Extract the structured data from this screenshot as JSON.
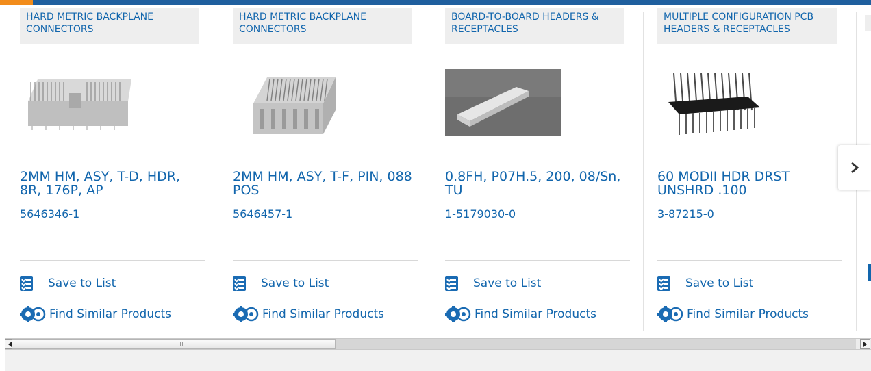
{
  "products": [
    {
      "category": "HARD METRIC BACKPLANE CONNECTORS",
      "title": "2MM HM, ASY, T-D, HDR, 8R, 176P, AP",
      "part_number": "5646346-1",
      "save_label": "Save to List",
      "similar_label": "Find Similar Products"
    },
    {
      "category": "HARD METRIC BACKPLANE CONNECTORS",
      "title": "2MM HM, ASY, T-F, PIN, 088 POS",
      "part_number": "5646457-1",
      "save_label": "Save to List",
      "similar_label": "Find Similar Products"
    },
    {
      "category": "BOARD-TO-BOARD HEADERS & RECEPTACLES",
      "title": "0.8FH, P07H.5, 200, 08/Sn, TU",
      "part_number": "1-5179030-0",
      "save_label": "Save to List",
      "similar_label": "Find Similar Products"
    },
    {
      "category": "MULTIPLE CONFIGURATION PCB HEADERS & RECEPTACLES",
      "title": "60 MODII HDR DRST UNSHRD .100",
      "part_number": "3-87215-0",
      "save_label": "Save to List",
      "similar_label": "Find Similar Products"
    }
  ],
  "carousel": {
    "next_icon": "chevron-right-icon"
  },
  "colors": {
    "link": "#1266ad",
    "topbar": "#1f5f9e",
    "accent": "#f28c1b",
    "category_bg": "#eeeeee"
  },
  "scrollbar": {
    "position_fraction": 0.0
  }
}
